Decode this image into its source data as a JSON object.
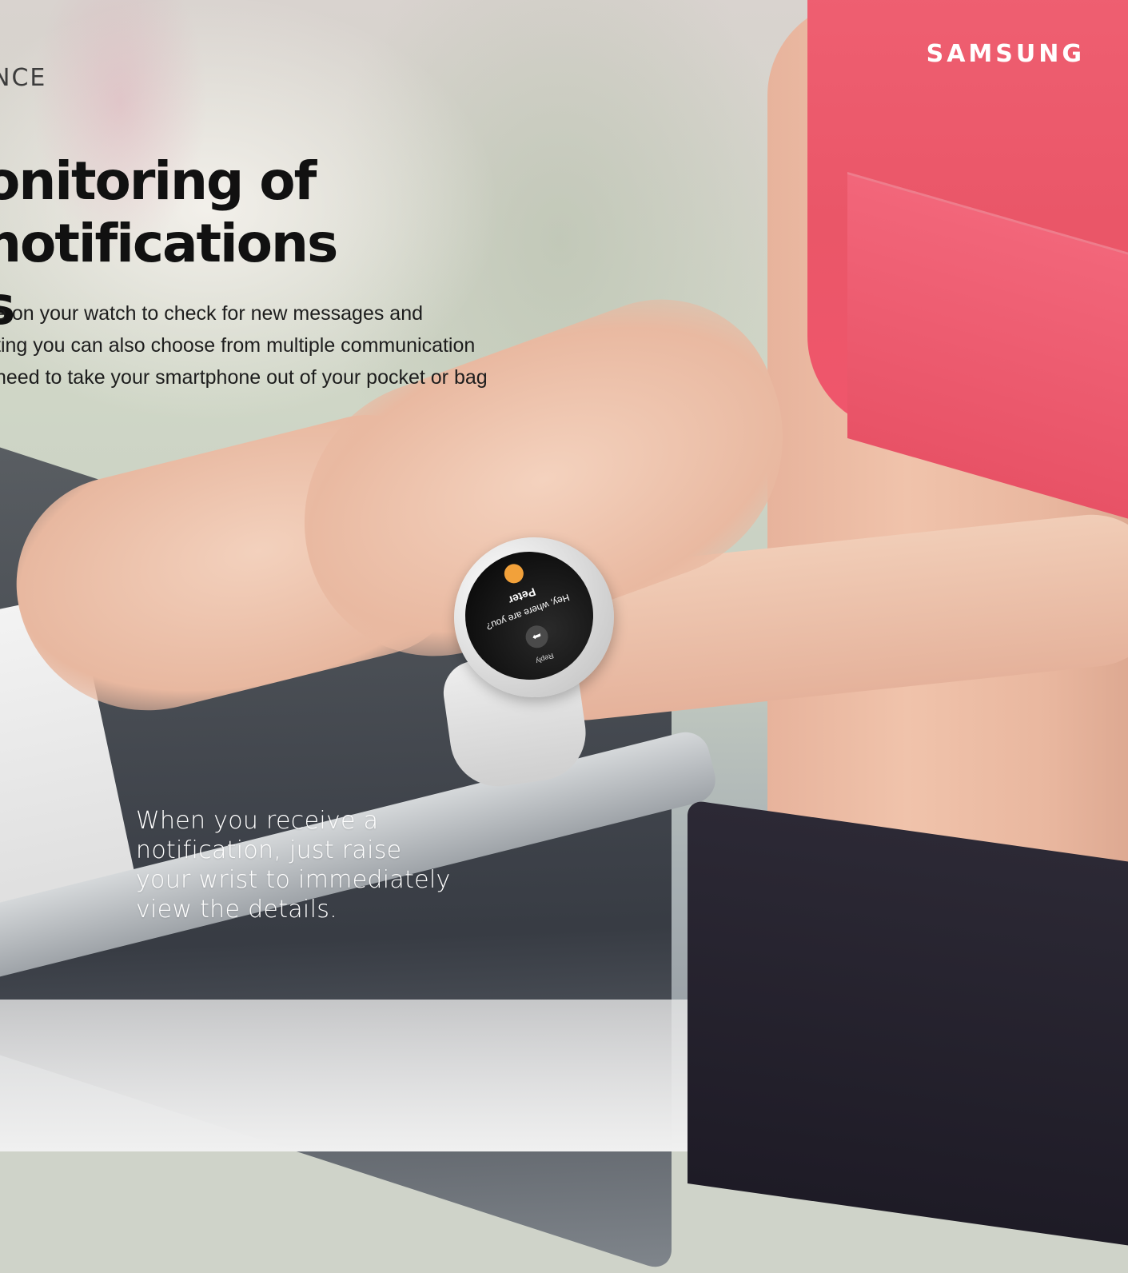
{
  "brand": {
    "logo_text": "SAMSUNG"
  },
  "section": {
    "label": "NCE"
  },
  "headline": {
    "line1": "onitoring of notifications",
    "line2": "s"
  },
  "body": {
    "lines": [
      "e on your watch to check for new messages and",
      "ting you can also choose from multiple communication",
      "need to take your smartphone out of your pocket or bag"
    ]
  },
  "watch": {
    "reply_label": "Reply",
    "message": "Hey, where are you?",
    "sender": "Peter",
    "reply_icon": "share-arrow-icon",
    "app_icon": "email-app-icon"
  },
  "caption": {
    "lines": [
      "When you receive a",
      "notification, just raise",
      "your wrist to immediately",
      "view the details."
    ]
  },
  "colors": {
    "bra": "#ea5668",
    "leggings": "#231f2c",
    "logo": "#ffffff"
  }
}
